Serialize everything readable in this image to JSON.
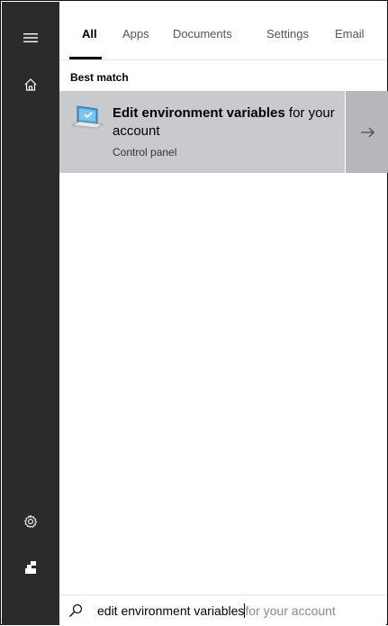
{
  "tabs": [
    {
      "label": "All",
      "active": true
    },
    {
      "label": "Apps",
      "active": false
    },
    {
      "label": "Documents",
      "active": false
    },
    {
      "label": "Settings",
      "active": false
    },
    {
      "label": "Email",
      "active": false
    }
  ],
  "results": {
    "section_label": "Best match",
    "item": {
      "title_bold": "Edit environment variables",
      "title_rest": " for your account",
      "subtitle": "Control panel",
      "icon": "control-panel-monitor-icon"
    }
  },
  "rail": {
    "icons": [
      "hamburger-menu-icon",
      "home-icon",
      "settings-gear-icon",
      "user-account-icon"
    ]
  },
  "search": {
    "typed": "edit environment variables",
    "suggestion": "for your account"
  },
  "colors": {
    "rail_bg": "#2b2b2b",
    "result_bg": "#c8cacd",
    "result_arrow_bg": "#b5b7ba"
  }
}
